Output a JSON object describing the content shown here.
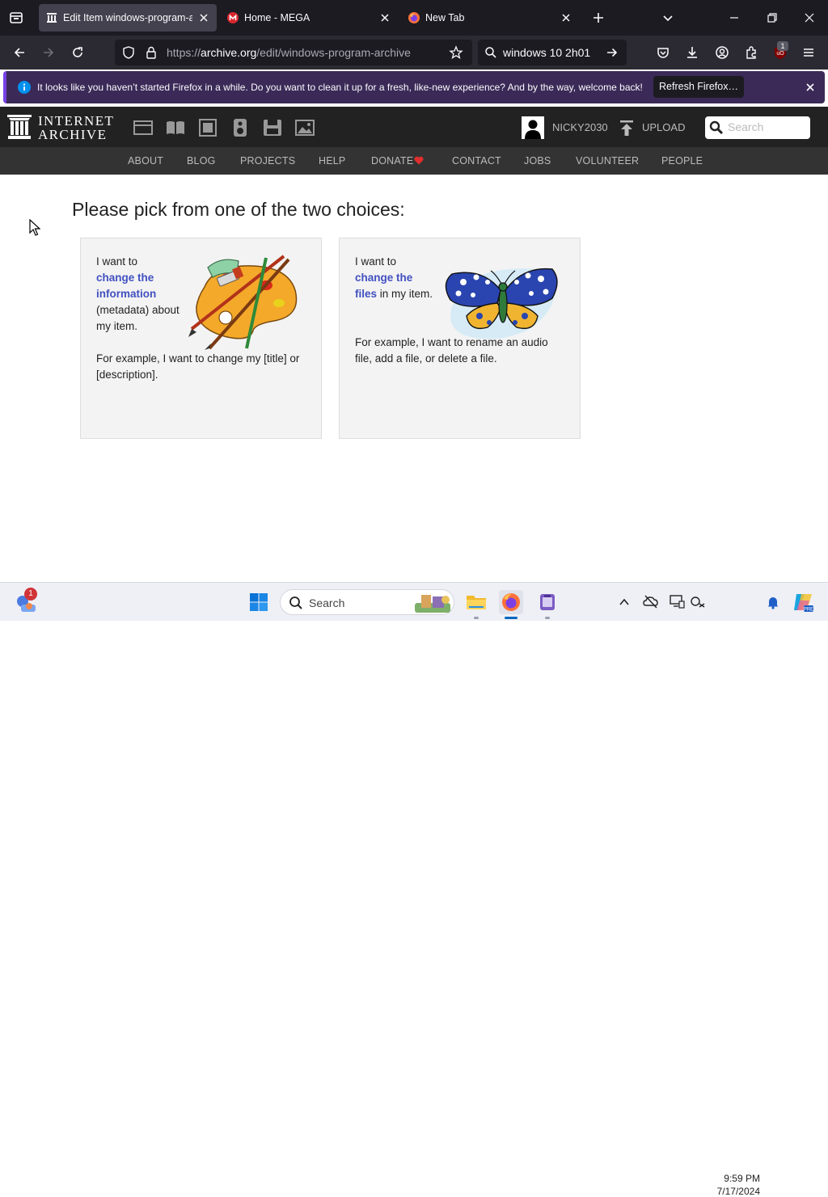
{
  "browser": {
    "tabs": [
      {
        "title": "Edit Item windows-program-archive",
        "favicon": "internet-archive-icon",
        "active": true
      },
      {
        "title": "Home - MEGA",
        "favicon": "mega-icon",
        "active": false
      },
      {
        "title": "New Tab",
        "favicon": "firefox-icon",
        "active": false
      }
    ],
    "url": {
      "protocol": "https://",
      "host": "archive.org",
      "path": "/edit/windows-program-archive"
    },
    "search_value": "windows 10 2h01",
    "extension_badge": "1",
    "notification": {
      "message": "It looks like you haven’t started Firefox in a while. Do you want to clean it up for a fresh, like-new experience? And by the way, welcome back!",
      "button_label": "Refresh Firefox…"
    }
  },
  "ia_header": {
    "logo_line1": "INTERNET",
    "logo_line2": "ARCHIVE",
    "media_icons": [
      "web-icon",
      "texts-icon",
      "video-icon",
      "audio-icon",
      "software-icon",
      "images-icon"
    ],
    "username": "NICKY2030",
    "upload_label": "UPLOAD",
    "search_placeholder": "Search",
    "menu": [
      "ABOUT",
      "BLOG",
      "PROJECTS",
      "HELP",
      "DONATE",
      "CONTACT",
      "JOBS",
      "VOLUNTEER",
      "PEOPLE"
    ]
  },
  "content": {
    "heading": "Please pick from one of the two choices:",
    "choice_metadata": {
      "intro": "I want to",
      "link": "change the information",
      "rest": "(metadata) about my item.",
      "example": "For example, I want to change my [title] or [description]."
    },
    "choice_files": {
      "intro": "I want to",
      "link": "change the files",
      "rest": "in my item.",
      "example": "For example, I want to rename an audio file, add a file, or delete a file."
    }
  },
  "taskbar": {
    "search_label": "Search",
    "widgets_badge": "1",
    "time": "9:59 PM",
    "date": "7/17/2024"
  },
  "colors": {
    "browser_bg": "#1c1b22",
    "toolbar_bg": "#2b2a33",
    "notification_bg": "#3b2a57",
    "ia_header_bg": "#222222",
    "ia_menu_bg": "#333333",
    "link": "#4150c0",
    "card_bg": "#f3f3f3",
    "donate_heart": "#e02e2e"
  }
}
